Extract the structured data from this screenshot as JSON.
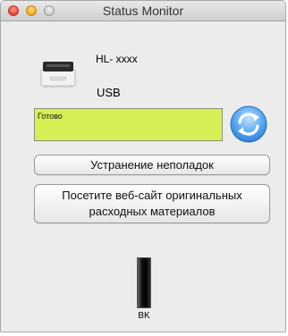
{
  "window": {
    "title": "Status Monitor"
  },
  "device": {
    "model": "HL- xxxx",
    "connection": "USB",
    "icon": "printer-icon"
  },
  "status": {
    "text": "Готово",
    "color": "#d4f054"
  },
  "buttons": {
    "refresh_icon": "refresh-icon",
    "troubleshoot": "Устранение неполадок",
    "website_line1": "Посетите веб-сайт оригинальных",
    "website_line2": "расходных материалов"
  },
  "toner": {
    "label": "BK",
    "level": 1.0,
    "color": "#000000"
  }
}
